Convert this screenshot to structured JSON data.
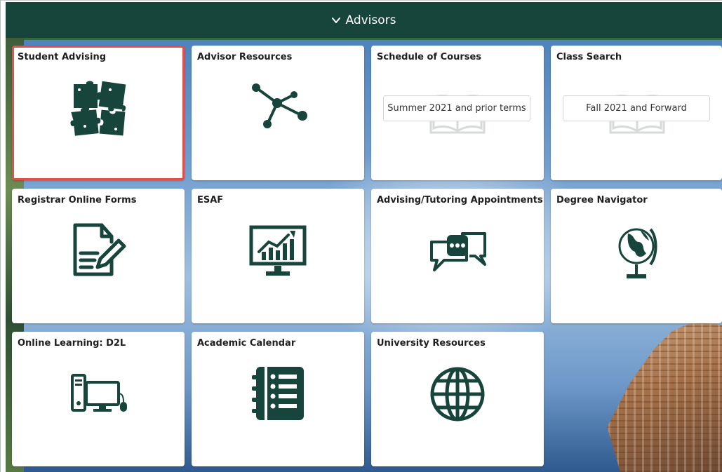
{
  "header": {
    "title": "Advisors"
  },
  "colors": {
    "brand_green": "#18453b",
    "selected_outline": "#e2504c"
  },
  "tiles": [
    {
      "title": "Student Advising",
      "icon": "puzzle-icon",
      "selected": true
    },
    {
      "title": "Advisor Resources",
      "icon": "network-icon"
    },
    {
      "title": "Schedule of Courses",
      "icon": "open-book-icon",
      "button_label": "Summer 2021 and prior terms"
    },
    {
      "title": "Class Search",
      "icon": "open-book-icon",
      "button_label": "Fall 2021 and Forward"
    },
    {
      "title": "Registrar Online Forms",
      "icon": "form-edit-icon"
    },
    {
      "title": "ESAF",
      "icon": "monitor-chart-icon"
    },
    {
      "title": "Advising/Tutoring Appointments",
      "icon": "chat-bubbles-icon"
    },
    {
      "title": "Degree Navigator",
      "icon": "globe-stand-icon"
    },
    {
      "title": "Online Learning: D2L",
      "icon": "computer-icon"
    },
    {
      "title": "Academic Calendar",
      "icon": "notebook-list-icon"
    },
    {
      "title": "University Resources",
      "icon": "globe-grid-icon"
    }
  ]
}
